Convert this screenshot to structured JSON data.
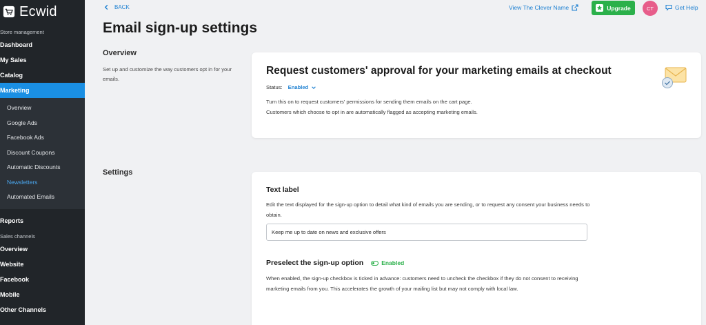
{
  "sidebar": {
    "logo": "Ecwid",
    "store_section": "Store management",
    "main_items": [
      {
        "label": "Dashboard"
      },
      {
        "label": "My Sales"
      },
      {
        "label": "Catalog"
      },
      {
        "label": "Marketing"
      }
    ],
    "marketing_sub": [
      {
        "label": "Overview"
      },
      {
        "label": "Google Ads"
      },
      {
        "label": "Facebook Ads"
      },
      {
        "label": "Discount Coupons"
      },
      {
        "label": "Automatic Discounts"
      },
      {
        "label": "Newsletters"
      },
      {
        "label": "Automated Emails"
      }
    ],
    "reports": "Reports",
    "channels_section": "Sales channels",
    "channels": [
      {
        "label": "Overview"
      },
      {
        "label": "Website"
      },
      {
        "label": "Facebook"
      },
      {
        "label": "Mobile"
      },
      {
        "label": "Other Channels"
      }
    ]
  },
  "topbar": {
    "back": "BACK",
    "view_link": "View The Clever Name",
    "upgrade": "Upgrade",
    "avatar": "CT",
    "help": "Get Help"
  },
  "page": {
    "title": "Email sign-up settings"
  },
  "overview": {
    "heading": "Overview",
    "desc": "Set up and customize the way customers opt in for your emails.",
    "card_title": "Request customers' approval for your marketing emails at checkout",
    "status_label": "Status:",
    "status_value": "Enabled",
    "desc_line1": "Turn this on to request customers' permissions for sending them emails on the cart page.",
    "desc_line2": "Customers which choose to opt in are automatically flagged as accepting marketing emails."
  },
  "settings": {
    "heading": "Settings",
    "text_label": "Text label",
    "text_label_desc": "Edit the text displayed for the sign-up option to detail what kind of emails you are sending, or to request any consent your business needs to obtain.",
    "text_value": "Keep me up to date on news and exclusive offers",
    "preselect_label": "Preselect the sign-up option",
    "preselect_state": "Enabled",
    "preselect_desc": "When enabled, the sign-up checkbox is ticked in advance: customers need to uncheck the checkbox if they do not consent to receiving marketing emails from you. This accelerates the growth of your mailing list but may not comply with local law."
  },
  "colors": {
    "sidebar_bg": "#212529",
    "accent": "#1a8fe3",
    "link": "#1b7fd1",
    "upgrade_green": "#2bb04a",
    "avatar_pink": "#e75d8a"
  }
}
